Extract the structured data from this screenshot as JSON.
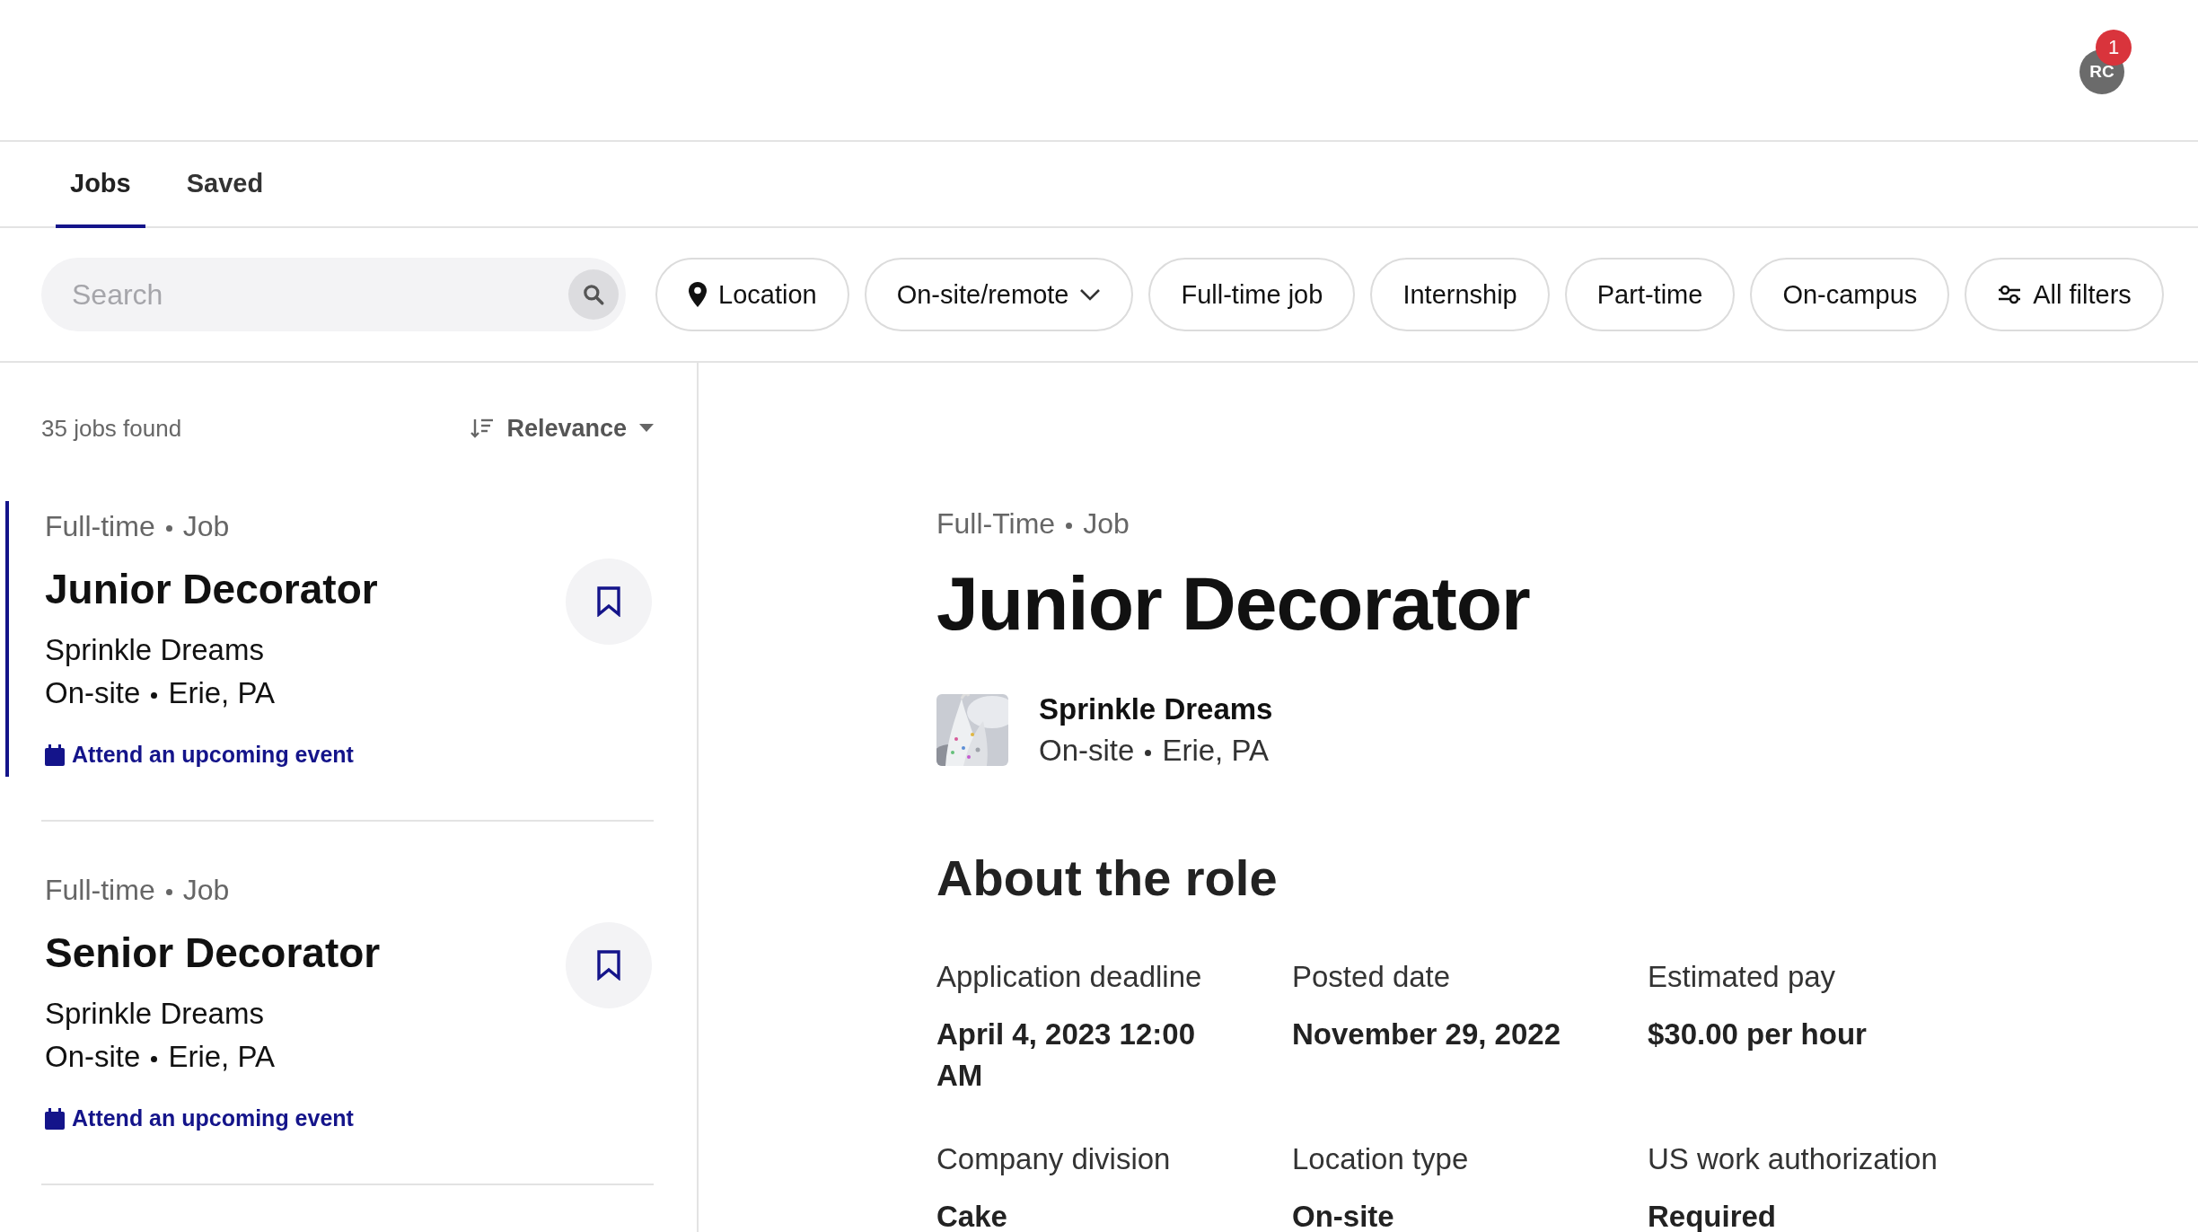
{
  "header": {
    "avatar_initials": "RC",
    "notification_count": "1"
  },
  "tabs": [
    {
      "label": "Jobs",
      "selected": true
    },
    {
      "label": "Saved",
      "selected": false
    }
  ],
  "search": {
    "placeholder": "Search"
  },
  "filters": [
    {
      "label": "Location",
      "kind": "location"
    },
    {
      "label": "On-site/remote",
      "kind": "dropdown"
    },
    {
      "label": "Full-time job",
      "kind": "plain"
    },
    {
      "label": "Internship",
      "kind": "plain"
    },
    {
      "label": "Part-time",
      "kind": "plain"
    },
    {
      "label": "On-campus",
      "kind": "plain"
    },
    {
      "label": "All filters",
      "kind": "filters"
    }
  ],
  "results": {
    "count": "35 jobs found",
    "sort": "Relevance"
  },
  "jobs": [
    {
      "type": "Full-time",
      "category": "Job",
      "title": "Junior Decorator",
      "company": "Sprinkle Dreams",
      "workplace": "On-site",
      "location": "Erie, PA",
      "event_link": "Attend an upcoming event",
      "selected": true
    },
    {
      "type": "Full-time",
      "category": "Job",
      "title": "Senior Decorator",
      "company": "Sprinkle Dreams",
      "workplace": "On-site",
      "location": "Erie, PA",
      "event_link": "Attend an upcoming event",
      "selected": false
    }
  ],
  "detail": {
    "type": "Full-Time",
    "category": "Job",
    "title": "Junior Decorator",
    "company": "Sprinkle Dreams",
    "workplace": "On-site",
    "location": "Erie, PA",
    "section_title": "About the role",
    "facts": [
      {
        "label": "Application deadline",
        "value": "April 4, 2023 12:00 AM"
      },
      {
        "label": "Posted date",
        "value": "November 29, 2022"
      },
      {
        "label": "Estimated pay",
        "value": "$30.00 per hour"
      },
      {
        "label": "Company division",
        "value": "Cake"
      },
      {
        "label": "Location type",
        "value": "On-site"
      },
      {
        "label": "US work authorization",
        "value": "Required"
      }
    ]
  }
}
